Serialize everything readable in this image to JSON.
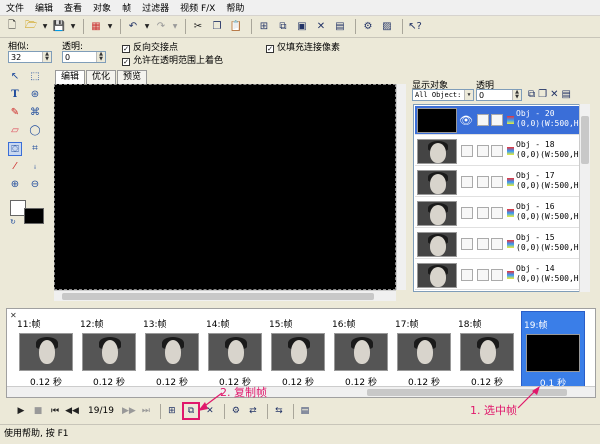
{
  "menu": [
    "文件",
    "编辑",
    "查看",
    "对象",
    "帧",
    "过滤器",
    "视频 F/X",
    "帮助"
  ],
  "options": {
    "similar_label": "相似:",
    "similar_value": "32",
    "transparent_label": "透明:",
    "transparent_value": "0",
    "reverse_contact": "反向交接点",
    "allow_transparent": "允许在透明范围上着色",
    "only_connected": "仅填充连接像素"
  },
  "editor_tabs": [
    "编辑",
    "优化",
    "预览"
  ],
  "objects": {
    "show_label": "显示对象",
    "transparent_label": "透明",
    "filter_value": "All Object:",
    "transparent_value": "0",
    "items": [
      {
        "name": "Obj - 20",
        "coords": "(0,0)(W:500,H:",
        "selected": true
      },
      {
        "name": "Obj - 18",
        "coords": "(0,0)(W:500,H:",
        "selected": false
      },
      {
        "name": "Obj - 17",
        "coords": "(0,0)(W:500,H:",
        "selected": false
      },
      {
        "name": "Obj - 16",
        "coords": "(0,0)(W:500,H:",
        "selected": false
      },
      {
        "name": "Obj - 15",
        "coords": "(0,0)(W:500,H:",
        "selected": false
      },
      {
        "name": "Obj - 14",
        "coords": "(0,0)(W:500,H:",
        "selected": false
      }
    ]
  },
  "frames": [
    {
      "label": "11:帧",
      "delay": "0.12 秒",
      "selected": false
    },
    {
      "label": "12:帧",
      "delay": "0.12 秒",
      "selected": false
    },
    {
      "label": "13:帧",
      "delay": "0.12 秒",
      "selected": false
    },
    {
      "label": "14:帧",
      "delay": "0.12 秒",
      "selected": false
    },
    {
      "label": "15:帧",
      "delay": "0.12 秒",
      "selected": false
    },
    {
      "label": "16:帧",
      "delay": "0.12 秒",
      "selected": false
    },
    {
      "label": "17:帧",
      "delay": "0.12 秒",
      "selected": false
    },
    {
      "label": "18:帧",
      "delay": "0.12 秒",
      "selected": false
    },
    {
      "label": "19:帧",
      "delay": "0.1 秒",
      "selected": true
    }
  ],
  "playback": {
    "counter": "19/19"
  },
  "annotations": {
    "copy_frame": "2. 复制帧",
    "select_frame": "1. 选中帧"
  },
  "status": "使用帮助, 按 F1",
  "colors": {
    "selection": "#3a6ed8",
    "annotation": "#e0186b"
  }
}
